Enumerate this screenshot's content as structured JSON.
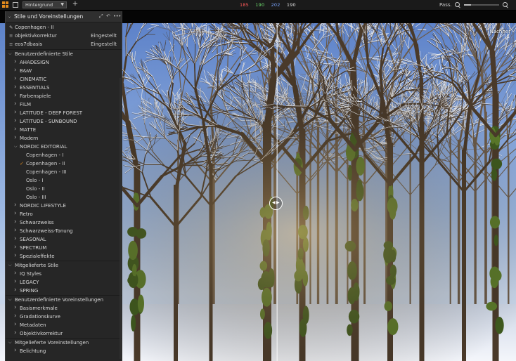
{
  "toolbar": {
    "preset": "Hintergrund",
    "rgb": {
      "r": "185",
      "g": "190",
      "b": "202",
      "l": "190"
    },
    "pass_label": "Pass.",
    "zoom_level": 0.2
  },
  "colors": {
    "accent": "#e28a1c",
    "red": "#ff5a5a",
    "green": "#6fdc6f",
    "blue": "#7aa6ff"
  },
  "viewer": {
    "after_label": "Nachher",
    "split_position": 0.537
  },
  "panel": {
    "title": "Stile und Voreinstellungen",
    "applied": [
      {
        "icon": "brush-icon",
        "name": "Copenhagen - II",
        "status": ""
      },
      {
        "icon": "lines-icon",
        "name": "objektivkorrektur",
        "status": "Eingestellt"
      },
      {
        "icon": "lines-icon",
        "name": "eos7dbasis",
        "status": "Eingestellt"
      }
    ],
    "tree": [
      {
        "level": 0,
        "label": "Benutzerdefinierte Stile",
        "expanded": true
      },
      {
        "level": 1,
        "label": "AHADESIGN"
      },
      {
        "level": 1,
        "label": "B&W"
      },
      {
        "level": 1,
        "label": "CINEMATIC"
      },
      {
        "level": 1,
        "label": "ESSENTIALS"
      },
      {
        "level": 1,
        "label": "Farbenspiele"
      },
      {
        "level": 1,
        "label": "FILM"
      },
      {
        "level": 1,
        "label": "LATITUDE - DEEP FOREST"
      },
      {
        "level": 1,
        "label": "LATITUDE - SUNBOUND"
      },
      {
        "level": 1,
        "label": "MATTE"
      },
      {
        "level": 1,
        "label": "Modern"
      },
      {
        "level": 1,
        "label": "NORDIC EDITORIAL",
        "expanded": true
      },
      {
        "level": 2,
        "label": "Copenhagen - I"
      },
      {
        "level": 2,
        "label": "Copenhagen - II",
        "checked": true
      },
      {
        "level": 2,
        "label": "Copenhagen - III"
      },
      {
        "level": 2,
        "label": "Oslo - I"
      },
      {
        "level": 2,
        "label": "Oslo - II"
      },
      {
        "level": 2,
        "label": "Oslo - III"
      },
      {
        "level": 1,
        "label": "NORDIC LIFESTYLE"
      },
      {
        "level": 1,
        "label": "Retro"
      },
      {
        "level": 1,
        "label": "Schwarzweiss"
      },
      {
        "level": 1,
        "label": "Schwarzweiss-Tonung"
      },
      {
        "level": 1,
        "label": "SEASONAL"
      },
      {
        "level": 1,
        "label": "SPECTRUM"
      },
      {
        "level": 1,
        "label": "Spezialeffekte"
      },
      {
        "level": 0,
        "label": "Mitgelieferte Stile",
        "expanded": true
      },
      {
        "level": 1,
        "label": "IQ Styles"
      },
      {
        "level": 1,
        "label": "LEGACY"
      },
      {
        "level": 1,
        "label": "SPRING"
      },
      {
        "level": 0,
        "label": "Benutzerdefinierte Voreinstellungen",
        "expanded": true
      },
      {
        "level": 1,
        "label": "Basismerkmale"
      },
      {
        "level": 1,
        "label": "Gradationskurve"
      },
      {
        "level": 1,
        "label": "Metadaten"
      },
      {
        "level": 1,
        "label": "Objektivkorrektur"
      },
      {
        "level": 0,
        "label": "Mitgelieferte Voreinstellungen",
        "expanded": true
      },
      {
        "level": 1,
        "label": "Belichtung"
      }
    ]
  }
}
